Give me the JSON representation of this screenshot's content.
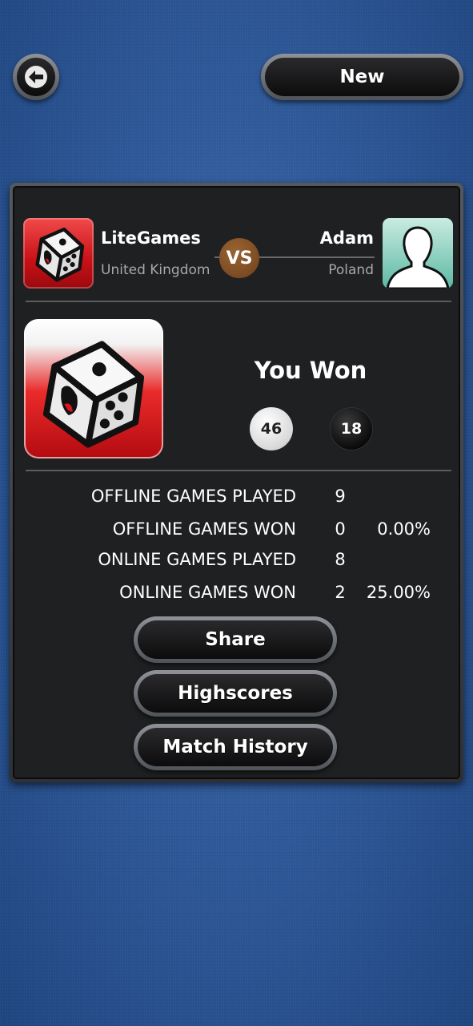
{
  "top_bar": {
    "back_icon": "left-arrow-icon",
    "new_button_label": "New"
  },
  "match": {
    "player1": {
      "name": "LiteGames",
      "country": "United Kingdom",
      "avatar": "dice-logo"
    },
    "vs_label": "VS",
    "player2": {
      "name": "Adam",
      "country": "Poland",
      "avatar": "silhouette-avatar"
    }
  },
  "result": {
    "title": "You Won",
    "score_player1": "46",
    "score_player2": "18"
  },
  "stats": [
    {
      "label": "OFFLINE GAMES PLAYED",
      "value": "9",
      "percent": ""
    },
    {
      "label": "OFFLINE GAMES WON",
      "value": "0",
      "percent": "0.00%"
    },
    {
      "label": "ONLINE GAMES PLAYED",
      "value": "8",
      "percent": ""
    },
    {
      "label": "ONLINE GAMES WON",
      "value": "2",
      "percent": "25.00%"
    }
  ],
  "actions": {
    "share_label": "Share",
    "highscores_label": "Highscores",
    "match_history_label": "Match History"
  },
  "colors": {
    "background_blue": "#2f5a9a",
    "panel_dark": "#1f2022",
    "vs_badge": "#7a4a22",
    "dice_red": "#d8151b"
  }
}
